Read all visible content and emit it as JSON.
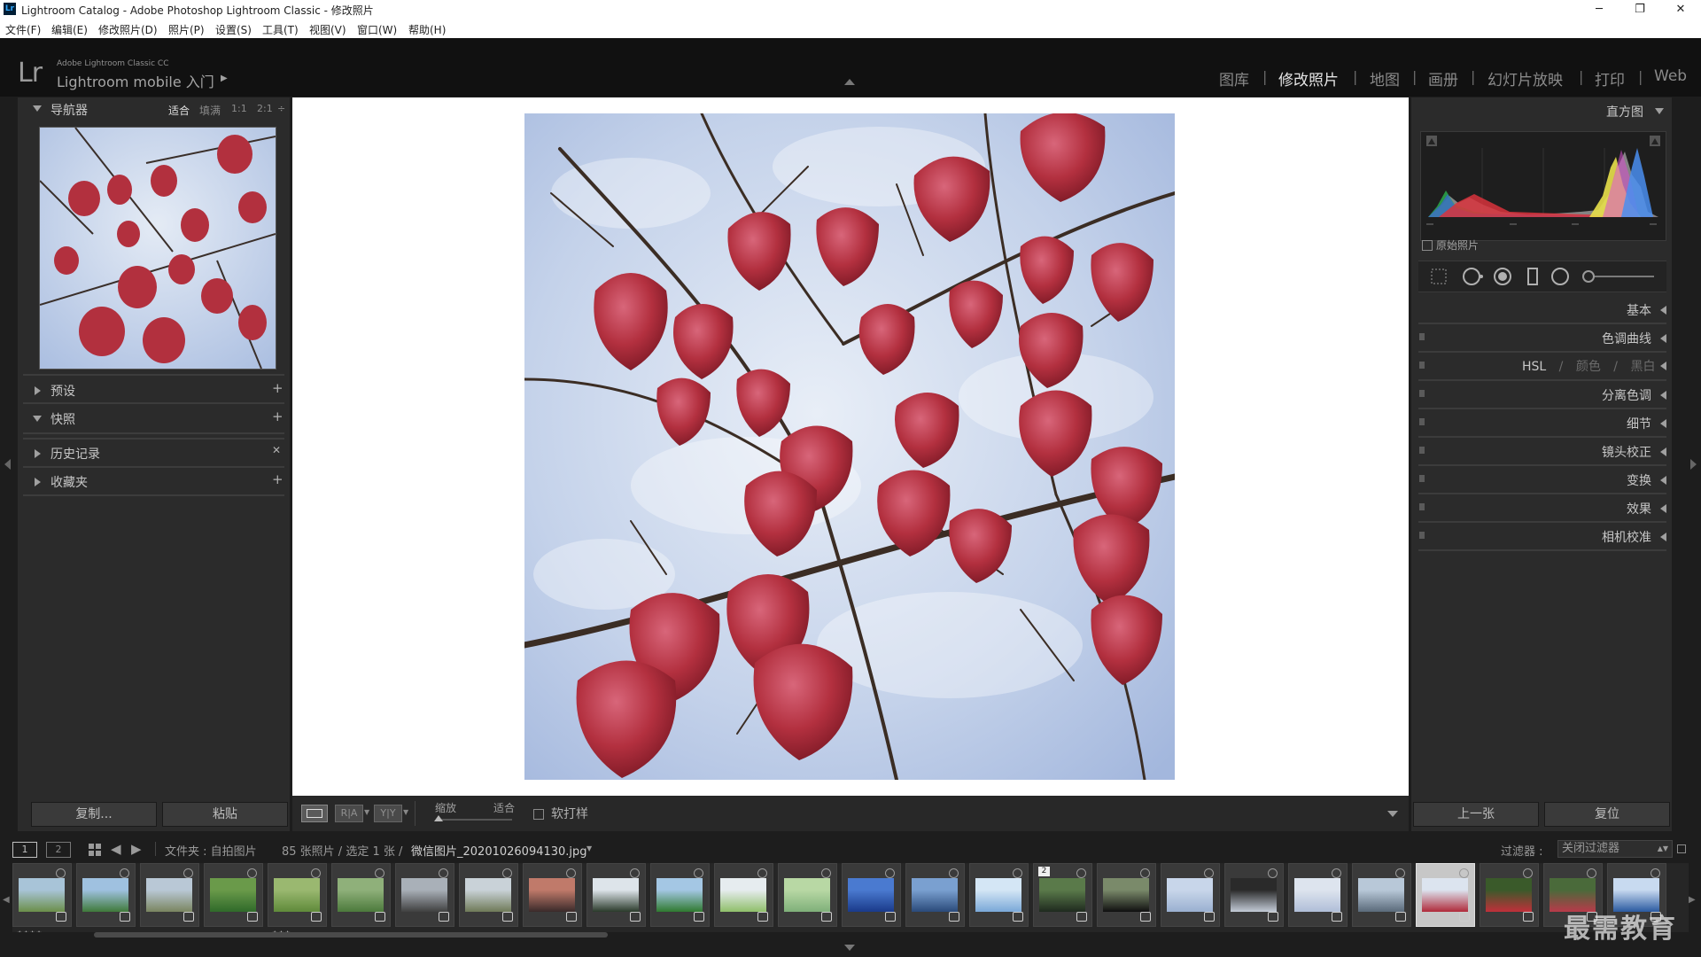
{
  "window": {
    "title": "Lightroom Catalog - Adobe Photoshop Lightroom Classic - 修改照片",
    "app_icon": "Lr",
    "controls": {
      "minimize": "─",
      "restore": "❐",
      "close": "✕"
    }
  },
  "menu": [
    "文件(F)",
    "编辑(E)",
    "修改照片(D)",
    "照片(P)",
    "设置(S)",
    "工具(T)",
    "视图(V)",
    "窗口(W)",
    "帮助(H)"
  ],
  "identity": {
    "logo": "Lr",
    "subtitle": "Adobe Lightroom Classic CC",
    "mobile": "Lightroom mobile 入门",
    "arrow": "▶"
  },
  "modules": [
    {
      "label": "图库",
      "active": false
    },
    {
      "label": "修改照片",
      "active": true
    },
    {
      "label": "地图",
      "active": false
    },
    {
      "label": "画册",
      "active": false
    },
    {
      "label": "幻灯片放映",
      "active": false
    },
    {
      "label": "打印",
      "active": false
    },
    {
      "label": "Web",
      "active": false
    }
  ],
  "left_panel": {
    "navigator": {
      "title": "导航器",
      "zoom_options": [
        "适合",
        "填满",
        "1:1",
        "2:1"
      ],
      "zoom_more": "÷"
    },
    "sections": [
      {
        "label": "预设",
        "action": "+",
        "expanded": false
      },
      {
        "label": "快照",
        "action": "+",
        "expanded": true
      },
      {
        "label": "历史记录",
        "action": "✕",
        "expanded": false
      },
      {
        "label": "收藏夹",
        "action": "+",
        "expanded": false
      }
    ],
    "copy_button": "复制...",
    "paste_button": "粘贴"
  },
  "right_panel": {
    "histogram_title": "直方图",
    "original_photo_label": "原始照片",
    "sections": [
      {
        "label": "基本",
        "has_toggle": false
      },
      {
        "label": "色调曲线",
        "has_toggle": true
      },
      {
        "label": "HSL",
        "extra": [
          "颜色",
          "黑白"
        ],
        "has_toggle": true
      },
      {
        "label": "分离色调",
        "has_toggle": true
      },
      {
        "label": "细节",
        "has_toggle": true
      },
      {
        "label": "镜头校正",
        "has_toggle": true
      },
      {
        "label": "变换",
        "has_toggle": true
      },
      {
        "label": "效果",
        "has_toggle": true
      },
      {
        "label": "相机校准",
        "has_toggle": true
      }
    ],
    "hsl_separator": "/",
    "prev_button": "上一张",
    "reset_button": "复位"
  },
  "toolbar": {
    "zoom_label": "缩放",
    "zoom_value": "适合",
    "softproof_label": "软打样",
    "ba_label": "R|A",
    "yy_label": "Y|Y"
  },
  "filmbar": {
    "view1": "1",
    "view2": "2",
    "source": "文件夹 : 自拍图片",
    "count": "85 张照片 / 选定 1 张 /",
    "filename": "微信图片_20201026094130.jpg",
    "filter_label": "过滤器 :",
    "filter_value": "关闭过滤器"
  },
  "filmstrip": [
    {
      "colors": [
        "#6b8f4a",
        "#a8c4d8"
      ],
      "rating": "★★★★"
    },
    {
      "colors": [
        "#3f7a3a",
        "#9fc1e0"
      ],
      "rating": ""
    },
    {
      "colors": [
        "#7a8560",
        "#b9c8d6"
      ],
      "rating": ""
    },
    {
      "colors": [
        "#2f6a2a",
        "#6a9a4a"
      ],
      "rating": ""
    },
    {
      "colors": [
        "#5f8a3a",
        "#9ab870"
      ],
      "rating": "★★★"
    },
    {
      "colors": [
        "#4c7a3c",
        "#8fb07a"
      ],
      "rating": ""
    },
    {
      "colors": [
        "#404040",
        "#a9b0b8"
      ],
      "rating": ""
    },
    {
      "colors": [
        "#6f7a58",
        "#c9d2d8"
      ],
      "rating": ""
    },
    {
      "colors": [
        "#3a2a2a",
        "#c07a6a"
      ],
      "rating": ""
    },
    {
      "colors": [
        "#2a3a2a",
        "#dde4ea"
      ],
      "rating": ""
    },
    {
      "colors": [
        "#2f7a2f",
        "#a4c7e4"
      ],
      "rating": ""
    },
    {
      "colors": [
        "#8fbf6a",
        "#e6ecef"
      ],
      "rating": ""
    },
    {
      "colors": [
        "#7fb07a",
        "#b8d8a4"
      ],
      "rating": ""
    },
    {
      "colors": [
        "#1a3a8a",
        "#4a7ad0"
      ],
      "rating": ""
    },
    {
      "colors": [
        "#2a4a7a",
        "#7aa0d0"
      ],
      "rating": ""
    },
    {
      "colors": [
        "#7aa8d8",
        "#d4e6f5"
      ],
      "rating": ""
    },
    {
      "colors": [
        "#1f2a1f",
        "#5a7a4a"
      ],
      "rating": "",
      "stack": "2"
    },
    {
      "colors": [
        "#101010",
        "#7a8a6a"
      ],
      "rating": ""
    },
    {
      "colors": [
        "#9ab0d0",
        "#c8d6ea"
      ],
      "rating": ""
    },
    {
      "colors": [
        "#c4ccd8",
        "#2a2a2a"
      ],
      "rating": ""
    },
    {
      "colors": [
        "#b0bed8",
        "#dde4ee"
      ],
      "rating": ""
    },
    {
      "colors": [
        "#5a6a7a",
        "#b8c8d8"
      ],
      "rating": ""
    },
    {
      "colors": [
        "#b02a3a",
        "#dce4ef"
      ],
      "rating": "",
      "selected": true
    },
    {
      "colors": [
        "#c0303a",
        "#3a5a2a"
      ],
      "rating": ""
    },
    {
      "colors": [
        "#b83a4a",
        "#4a6a3a"
      ],
      "rating": ""
    },
    {
      "colors": [
        "#2a5aa0",
        "#c8daf0"
      ],
      "rating": ""
    }
  ],
  "watermark": "最需教育"
}
